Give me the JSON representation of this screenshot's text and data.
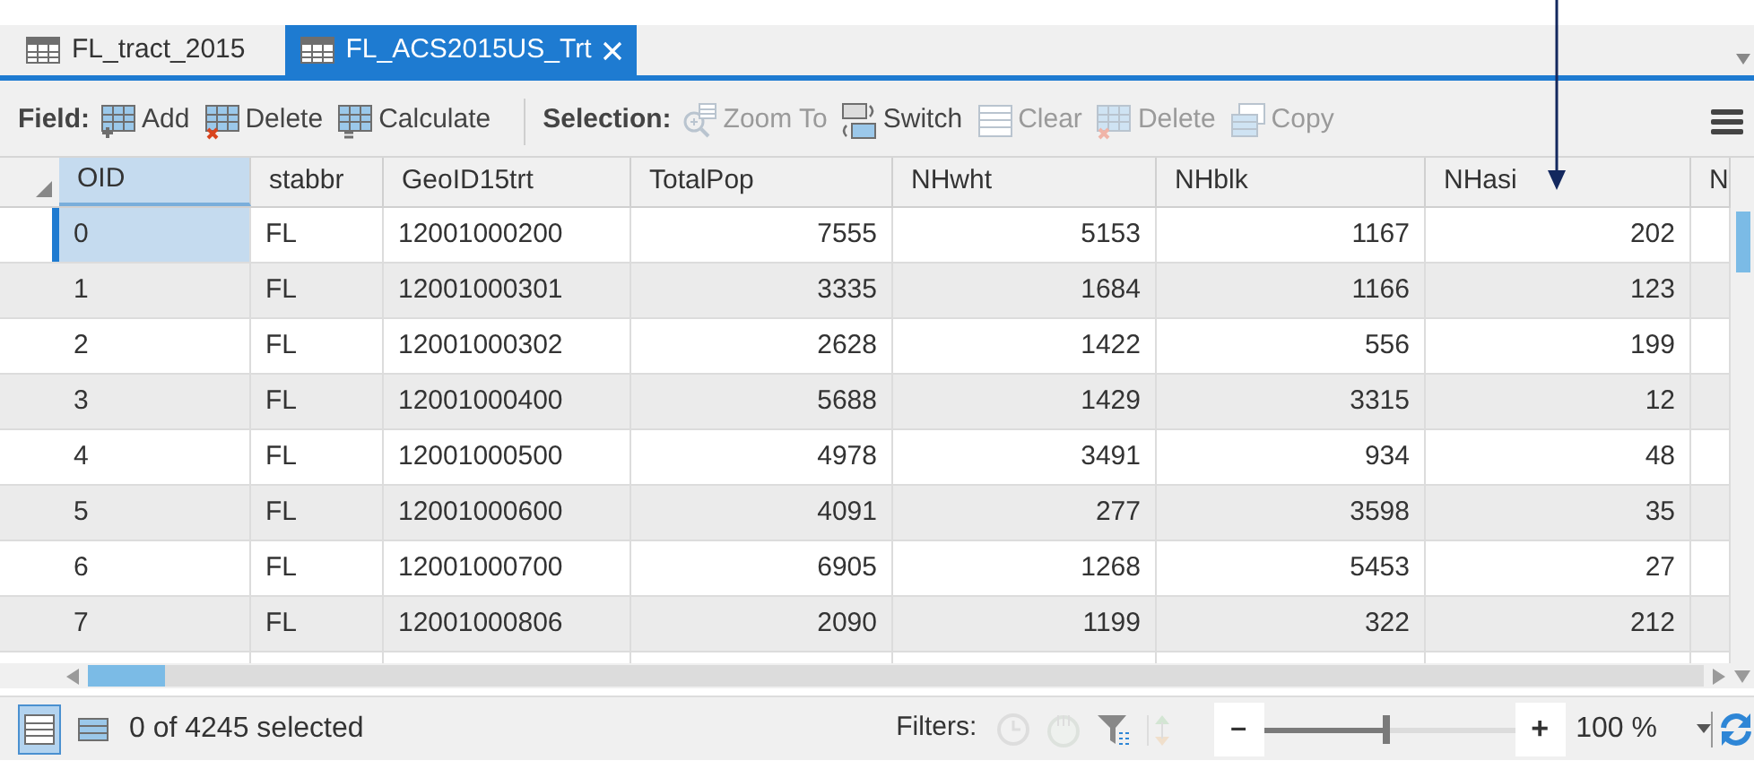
{
  "tabs": [
    {
      "label": "FL_tract_2015",
      "selected": false,
      "closable": false
    },
    {
      "label": "FL_ACS2015US_Trt",
      "selected": true,
      "closable": true
    }
  ],
  "toolbar": {
    "groups": [
      {
        "label": "Field:",
        "buttons": [
          {
            "label": "Add",
            "kind": "add",
            "disabled": false
          },
          {
            "label": "Delete",
            "kind": "delete",
            "disabled": false
          },
          {
            "label": "Calculate",
            "kind": "calc",
            "disabled": false
          }
        ]
      },
      {
        "label": "Selection:",
        "buttons": [
          {
            "label": "Zoom To",
            "kind": "zoom",
            "disabled": true
          },
          {
            "label": "Switch",
            "kind": "switch",
            "disabled": false
          },
          {
            "label": "Clear",
            "kind": "clear",
            "disabled": true
          },
          {
            "label": "Delete",
            "kind": "delete",
            "disabled": true
          },
          {
            "label": "Copy",
            "kind": "copy",
            "disabled": true
          }
        ]
      }
    ]
  },
  "table": {
    "columns": [
      {
        "label": "OID",
        "selected": true
      },
      {
        "label": "stabbr",
        "selected": false
      },
      {
        "label": "GeoID15trt",
        "selected": false
      },
      {
        "label": "TotalPop",
        "selected": false
      },
      {
        "label": "NHwht",
        "selected": false
      },
      {
        "label": "NHblk",
        "selected": false
      },
      {
        "label": "NHasi",
        "selected": false
      },
      {
        "label": "N",
        "selected": false
      }
    ],
    "rows": [
      {
        "selected": true,
        "cells": [
          "0",
          "FL",
          "12001000200",
          "7555",
          "5153",
          "1167",
          "202"
        ]
      },
      {
        "selected": false,
        "cells": [
          "1",
          "FL",
          "12001000301",
          "3335",
          "1684",
          "1166",
          "123"
        ]
      },
      {
        "selected": false,
        "cells": [
          "2",
          "FL",
          "12001000302",
          "2628",
          "1422",
          "556",
          "199"
        ]
      },
      {
        "selected": false,
        "cells": [
          "3",
          "FL",
          "12001000400",
          "5688",
          "1429",
          "3315",
          "12"
        ]
      },
      {
        "selected": false,
        "cells": [
          "4",
          "FL",
          "12001000500",
          "4978",
          "3491",
          "934",
          "48"
        ]
      },
      {
        "selected": false,
        "cells": [
          "5",
          "FL",
          "12001000600",
          "4091",
          "277",
          "3598",
          "35"
        ]
      },
      {
        "selected": false,
        "cells": [
          "6",
          "FL",
          "12001000700",
          "6905",
          "1268",
          "5453",
          "27"
        ]
      },
      {
        "selected": false,
        "cells": [
          "7",
          "FL",
          "12001000806",
          "2090",
          "1199",
          "322",
          "212"
        ]
      }
    ]
  },
  "status_bar": {
    "views": [
      {
        "selected": true
      },
      {
        "selected": false
      }
    ],
    "selection_text": "0 of 4245 selected",
    "filters_label": "Filters:",
    "filters": [
      {
        "kind": "clock",
        "disabled": true
      },
      {
        "kind": "extent",
        "disabled": true
      },
      {
        "kind": "filter",
        "disabled": false
      },
      {
        "kind": "arrows",
        "disabled": true
      }
    ],
    "zoom_out": "–",
    "zoom_in": "+",
    "zoom": {
      "level": 0.49
    },
    "zoom_value": "100 %"
  }
}
